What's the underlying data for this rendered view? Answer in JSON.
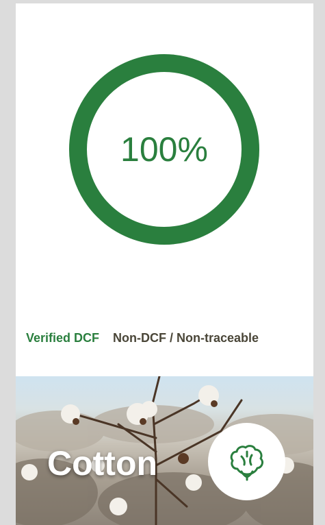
{
  "progress": {
    "percent_label": "100%",
    "value": 1.0,
    "color": "#2a7f3e"
  },
  "legend": {
    "verified_label": "Verified DCF",
    "non_dcf_label": "Non-DCF / Non-traceable",
    "verified_color": "#2a7f3e",
    "non_dcf_color": "#4a4638"
  },
  "material": {
    "title": "Cotton",
    "icon": "cotton-boll-icon"
  }
}
